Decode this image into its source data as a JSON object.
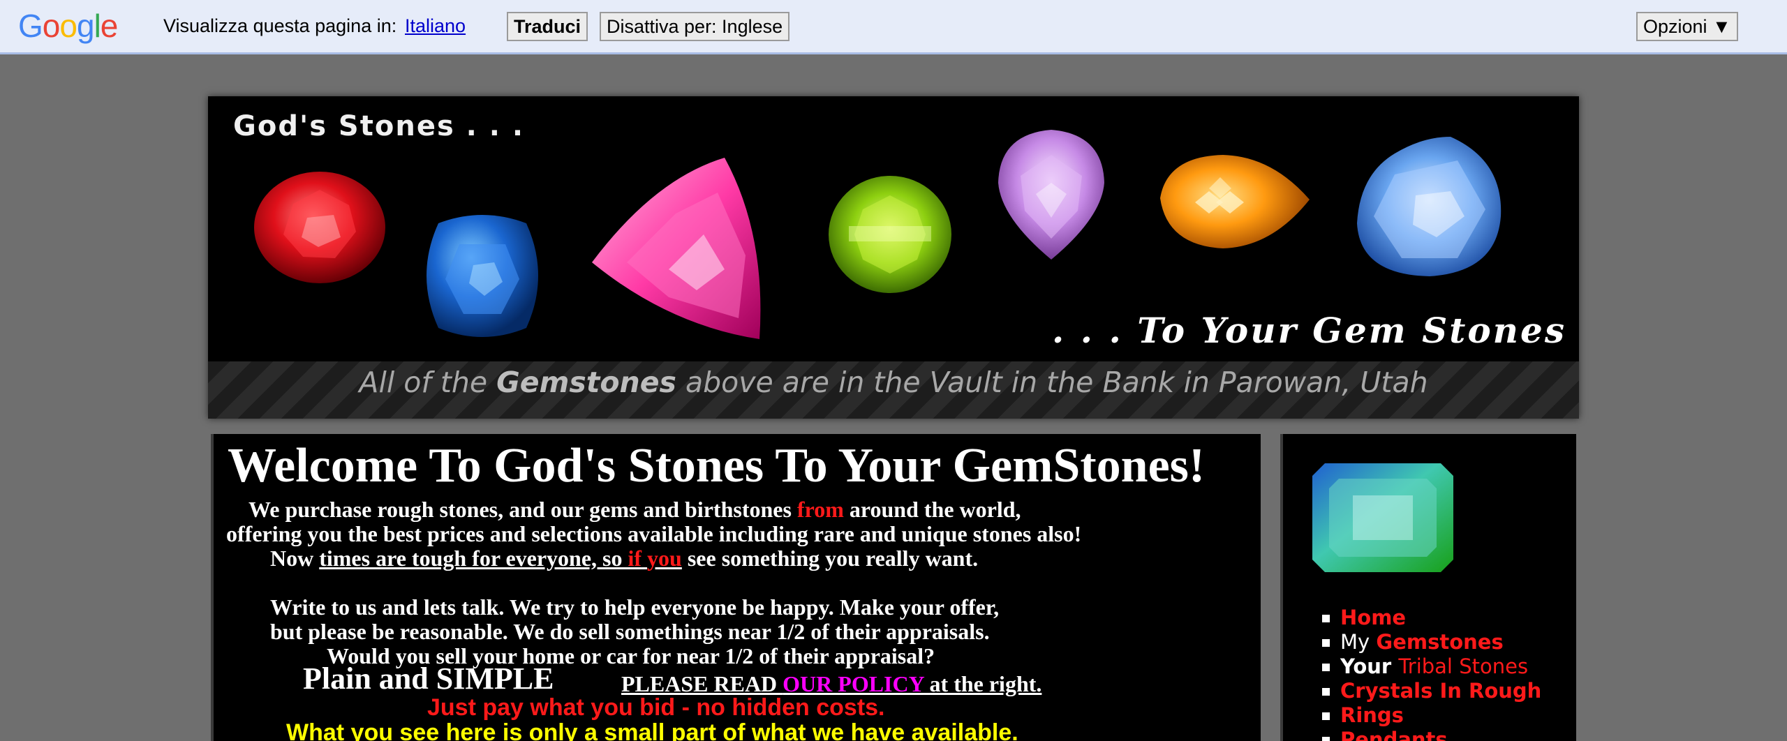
{
  "translate_bar": {
    "logo": [
      "G",
      "o",
      "o",
      "g",
      "l",
      "e"
    ],
    "logo_colors": [
      "#4285f4",
      "#ea4335",
      "#fbbc05",
      "#4285f4",
      "#34a853",
      "#ea4335"
    ],
    "label": "Visualizza questa pagina in:",
    "language_link": "Italiano",
    "translate_button": "Traduci",
    "disable_button": "Disattiva per: Inglese",
    "options_button": "Opzioni ▼"
  },
  "banner": {
    "title": "God's Stones . . .",
    "tagline": ". . . To Your Gem Stones",
    "caption_pre": "All of the ",
    "caption_bold": "Gemstones",
    "caption_post": " above are in the Vault in the Bank in Parowan, Utah"
  },
  "main": {
    "heading": "Welcome To God's Stones To Your GemStones!",
    "line1_a": "We purchase rough stones, and our gems and birthstones ",
    "line1_red": "from",
    "line1_b": " around the world,",
    "line2": "offering you the best prices and selections available including rare and unique stones also!",
    "line3_a": "Now ",
    "line3_u": "times are tough for everyone, so ",
    "line3_red1": "if",
    "line3_sp": " ",
    "line3_red2": "you",
    "line3_b": " see something you really want.",
    "line4": "Write to us and lets talk. We try to help everyone be happy. Make your offer,",
    "line5": "but please be reasonable. We do sell somethings near 1/2 of their appraisals.",
    "line6": "Would you sell your home or car for near 1/2 of their appraisal?",
    "plain": "Plain and SIMPLE",
    "policy_a": "PLEASE READ ",
    "policy_link": "OUR POLICY",
    "policy_b": "  at the right. ",
    "red_line": "Just pay what you bid - no hidden costs.",
    "yellow_line": "What you see here is only a small part of what we have available."
  },
  "sidebar": {
    "nav": [
      {
        "w": "",
        "r": "Home"
      },
      {
        "w": " My ",
        "r": "Gemstones"
      },
      {
        "w": "Your ",
        "r": "Tribal Stones"
      },
      {
        "w": "",
        "r": "Crystals In Rough"
      },
      {
        "w": "",
        "r": "Rings"
      },
      {
        "w": "",
        "r": "Pendants"
      }
    ]
  },
  "colors": {
    "page_bg": "#6f6f6f",
    "panel_bg": "#000000",
    "accent_red": "#ff1a1a",
    "accent_magenta": "#ff00ff",
    "accent_yellow": "#ffff00",
    "link_blue": "#0000cc"
  },
  "icons": [
    "google-logo",
    "ruby-gem-icon",
    "sapphire-gem-icon",
    "pink-trillion-gem-icon",
    "peridot-gem-icon",
    "amethyst-pear-gem-icon",
    "citrine-briolette-gem-icon",
    "blue-topaz-gem-icon",
    "tourmaline-emerald-cut-gem-icon"
  ]
}
